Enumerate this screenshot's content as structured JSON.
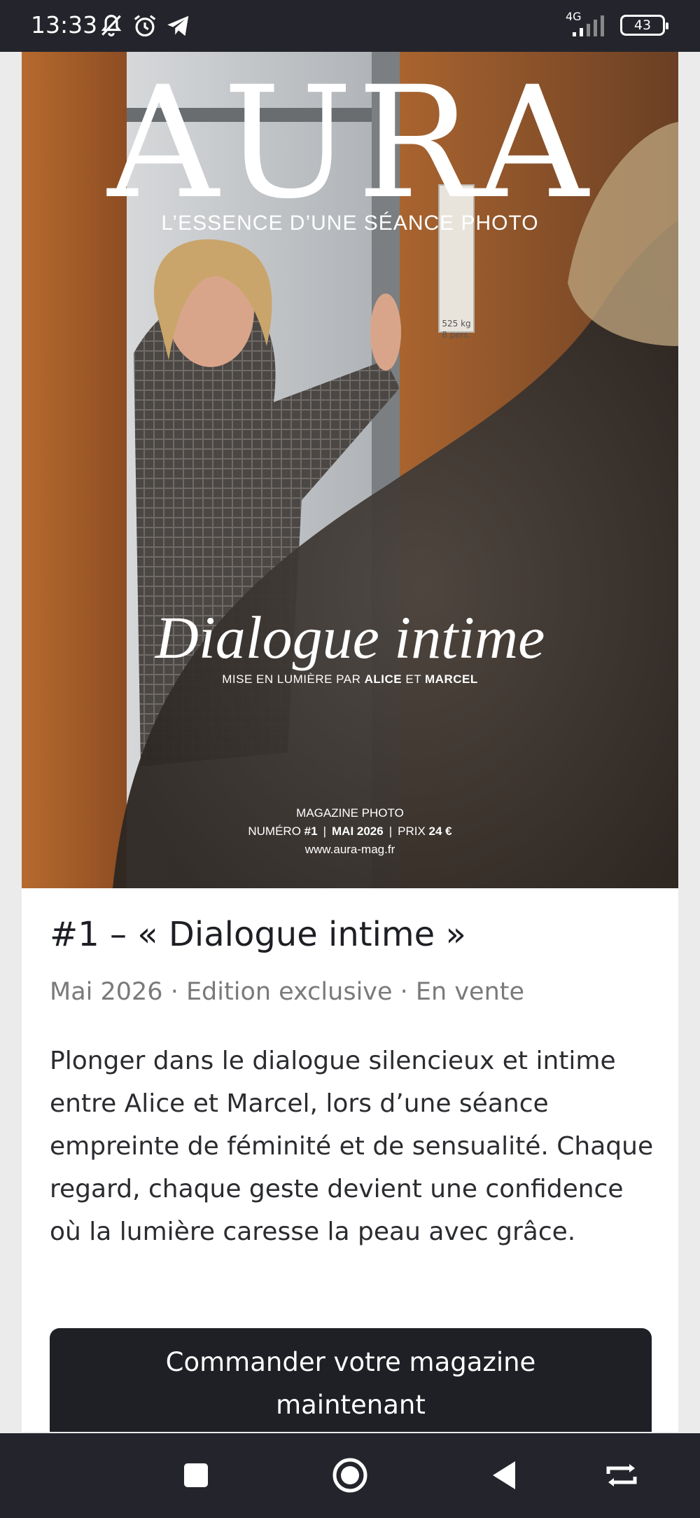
{
  "status_bar": {
    "time": "13:33",
    "network": "4G",
    "battery": "43",
    "icons": [
      "bell-muted-icon",
      "alarm-icon",
      "telegram-icon",
      "signal-icon",
      "battery-icon"
    ]
  },
  "cover": {
    "masthead": "AURA",
    "tagline": "L’ESSENCE D’UNE SÉANCE PHOTO",
    "title": "Dialogue intime",
    "credit_prefix": "MISE EN LUMIÈRE PAR",
    "credit_name_1": "ALICE",
    "credit_join": "ET",
    "credit_name_2": "MARCEL",
    "magazine_label": "MAGAZINE PHOTO",
    "issue_prefix": "NUMÉRO",
    "issue_number": "#1",
    "issue_date": "MAI 2026",
    "price_prefix": "PRIX",
    "price": "24 €",
    "website": "www.aura-mag.fr",
    "sign_top": "525 kg",
    "sign_bottom": "8 pers."
  },
  "issue": {
    "title": "#1 – « Dialogue intime »",
    "meta": "Mai 2026 · Edition exclusive · En vente",
    "description": "Plonger dans le dialogue silencieux et intime entre Alice et Marcel, lors d’une séance empreinte de féminité et de sensualité. Chaque regard, chaque geste devient une confidence où la lumière caresse la peau avec grâce.",
    "order_line1": "Commander votre magazine",
    "order_line2": "maintenant"
  },
  "nav": {
    "icons": [
      "recents-square-icon",
      "home-circle-icon",
      "back-triangle-icon",
      "rotate-icon"
    ]
  },
  "colors": {
    "status_bg": "#24252c",
    "button_bg": "#1f2026",
    "meta_text": "#7a7a7a",
    "body_text": "#2b2c30"
  }
}
